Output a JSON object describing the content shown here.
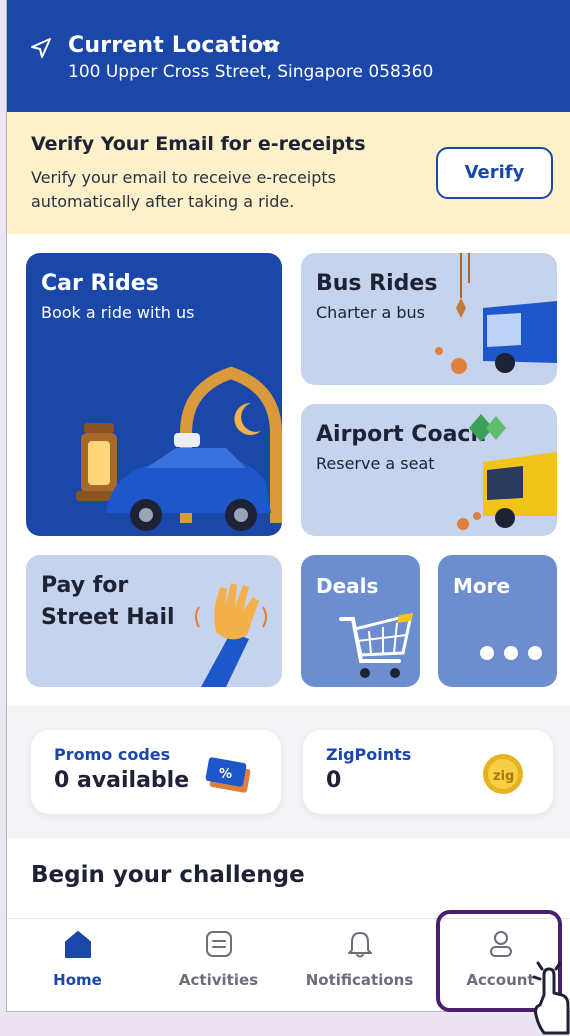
{
  "header": {
    "title": "Current Location",
    "address": "100 Upper Cross Street, Singapore 058360"
  },
  "banner": {
    "title": "Verify Your Email for e-receipts",
    "description": "Verify your email to receive e-receipts automatically after taking a ride.",
    "button_label": "Verify"
  },
  "services": {
    "car": {
      "title": "Car Rides",
      "subtitle": "Book a ride with us"
    },
    "bus": {
      "title": "Bus Rides",
      "subtitle": "Charter a bus"
    },
    "coach": {
      "title": "Airport Coach",
      "subtitle": "Reserve a seat"
    },
    "hail": {
      "title_line1": "Pay for",
      "title_line2": "Street Hail"
    },
    "deals": {
      "title": "Deals"
    },
    "more": {
      "title": "More"
    }
  },
  "promo": {
    "title": "Promo codes",
    "value": "0 available"
  },
  "zigpoints": {
    "title": "ZigPoints",
    "value": "0"
  },
  "challenge": {
    "title": "Begin your challenge"
  },
  "bottom_nav": {
    "items": [
      {
        "label": "Home",
        "icon": "home-icon"
      },
      {
        "label": "Activities",
        "icon": "activities-icon"
      },
      {
        "label": "Notifications",
        "icon": "bell-icon"
      },
      {
        "label": "Account",
        "icon": "person-icon"
      }
    ]
  },
  "colors": {
    "brand_blue": "#1a47a8",
    "banner_bg": "#fdf1cb",
    "tile_light": "#c6d3ec",
    "tile_mid": "#6c8ecf",
    "highlight": "#4a1f6d"
  }
}
